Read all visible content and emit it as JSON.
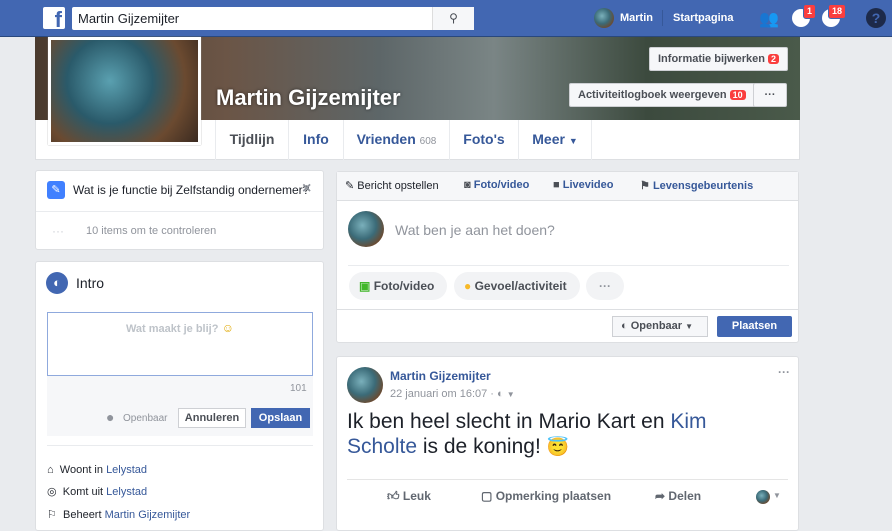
{
  "topbar": {
    "logo": "f",
    "search_value": "Martin Gijzemijter",
    "user_name": "Martin",
    "home": "Startpagina",
    "messages_badge": "1",
    "notifications_badge": "18",
    "help": "?"
  },
  "cover": {
    "name": "Martin Gijzemijter",
    "update_info": "Informatie bijwerken",
    "update_info_badge": "2",
    "activity_log": "Activiteitlogboek weergeven",
    "activity_log_badge": "10",
    "more": "···"
  },
  "tabs": [
    {
      "label": "Tijdlijn"
    },
    {
      "label": "Info"
    },
    {
      "label": "Vrienden",
      "count": "608"
    },
    {
      "label": "Foto's"
    },
    {
      "label": "Meer"
    }
  ],
  "prompt": {
    "question": "Wat is je functie bij Zelfstandig ondernemer?",
    "close": "×",
    "dots": "···",
    "review": "10 items om te controleren"
  },
  "intro": {
    "title": "Intro",
    "placeholder": "Wat maakt je blij?",
    "char_count": "101",
    "privacy": "Openbaar",
    "cancel": "Annuleren",
    "save": "Opslaan",
    "items": [
      {
        "prefix": "Woont in",
        "link": "Lelystad"
      },
      {
        "prefix": "Komt uit",
        "link": "Lelystad"
      },
      {
        "prefix": "Beheert",
        "link": "Martin Gijzemijter"
      }
    ]
  },
  "composer": {
    "tabs": [
      "Bericht opstellen",
      "Foto/video",
      "Livevideo",
      "Levensgebeurtenis"
    ],
    "placeholder": "Wat ben je aan het doen?",
    "photo": "Foto/video",
    "feeling": "Gevoel/activiteit",
    "more": "···",
    "privacy": "Openbaar",
    "post": "Plaatsen"
  },
  "post": {
    "author": "Martin Gijzemijter",
    "time": "22 januari om 16:07",
    "text_before": "Ik ben heel slecht in Mario Kart en ",
    "mention": "Kim Scholte",
    "text_after": " is de koning! ",
    "emoji": "😇",
    "menu": "···",
    "like": "Leuk",
    "comment": "Opmerking plaatsen",
    "share": "Delen"
  },
  "colors": {
    "brand": "#4267b2",
    "link": "#365899",
    "badge": "#fa3e3e"
  }
}
